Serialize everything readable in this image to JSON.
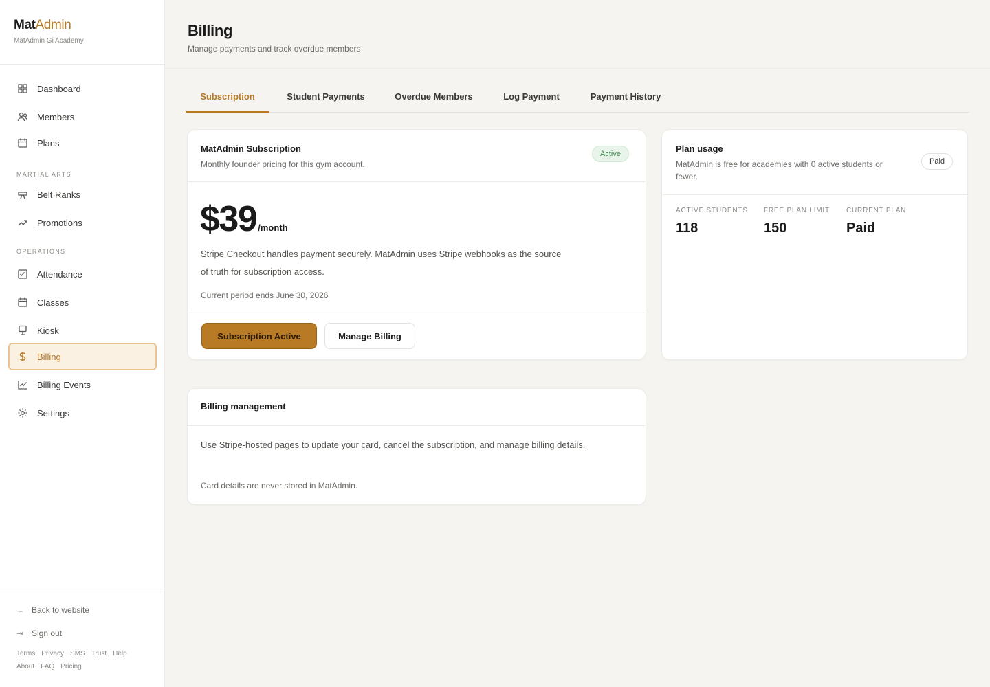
{
  "brand": {
    "name_part1": "Mat",
    "name_part2": "Admin",
    "subtitle": "MatAdmin Gi Academy"
  },
  "sidebar": {
    "items": [
      {
        "label": "Dashboard",
        "icon": "grid-icon"
      },
      {
        "label": "Members",
        "icon": "users-icon"
      },
      {
        "label": "Plans",
        "icon": "calendar-icon"
      }
    ],
    "section_martial": "Martial Arts",
    "martial_items": [
      {
        "label": "Belt Ranks",
        "icon": "belt-icon"
      },
      {
        "label": "Promotions",
        "icon": "trend-up-icon"
      }
    ],
    "section_operations": "Operations",
    "operations_items": [
      {
        "label": "Attendance",
        "icon": "checklist-icon"
      },
      {
        "label": "Classes",
        "icon": "calendar-icon"
      },
      {
        "label": "Kiosk",
        "icon": "kiosk-icon"
      },
      {
        "label": "Billing",
        "icon": "dollar-icon",
        "active": true
      },
      {
        "label": "Billing Events",
        "icon": "chart-icon"
      },
      {
        "label": "Settings",
        "icon": "gear-icon"
      }
    ],
    "footer": {
      "back_label": "Back to website",
      "signout_label": "Sign out",
      "legal_row1": [
        "Terms",
        "Privacy",
        "SMS",
        "Trust",
        "Help"
      ],
      "legal_row2": [
        "About",
        "FAQ",
        "Pricing"
      ]
    }
  },
  "header": {
    "title": "Billing",
    "subtitle": "Manage payments and track overdue members"
  },
  "tabs": [
    {
      "label": "Subscription",
      "active": true
    },
    {
      "label": "Student Payments"
    },
    {
      "label": "Overdue Members"
    },
    {
      "label": "Log Payment"
    },
    {
      "label": "Payment History"
    }
  ],
  "subscription_card": {
    "title": "MatAdmin Subscription",
    "description": "Monthly founder pricing for this gym account.",
    "status_badge": "Active",
    "price": "$39",
    "period": "/month",
    "body": "Stripe Checkout handles payment securely. MatAdmin uses Stripe webhooks as the source of truth for subscription access.",
    "period_end": "Current period ends June 30, 2026",
    "primary_button": "Subscription Active",
    "secondary_button": "Manage Billing"
  },
  "plan_usage": {
    "title": "Plan usage",
    "description": "MatAdmin is free for academies with 0 active students or fewer.",
    "badge": "Paid",
    "stats": [
      {
        "label": "Active students",
        "value": "118"
      },
      {
        "label": "Free plan limit",
        "value": "150"
      },
      {
        "label": "Current plan",
        "value": "Paid"
      }
    ]
  },
  "billing_management": {
    "title": "Billing management",
    "body": "Use Stripe-hosted pages to update your card, cancel the subscription, and manage billing details.",
    "note": "Card details are never stored in MatAdmin."
  },
  "colors": {
    "accent": "#b87a24",
    "success": "#3e8b4f",
    "background": "#f5f4f1"
  }
}
